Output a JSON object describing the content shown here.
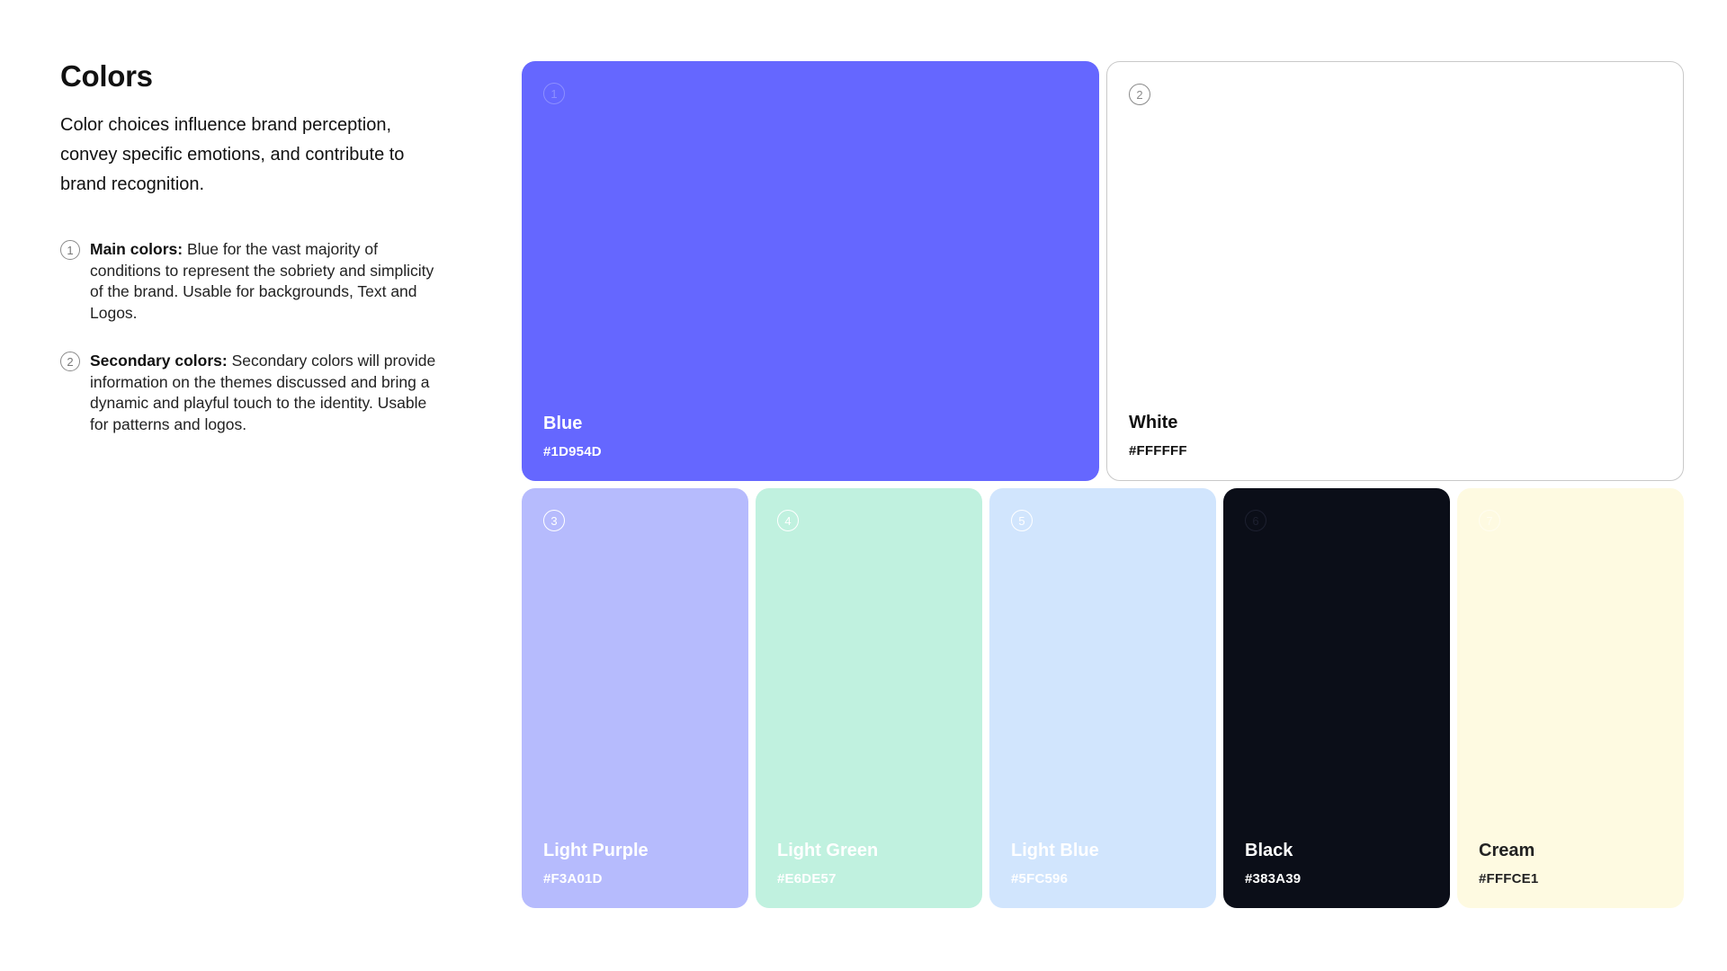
{
  "heading": {
    "title": "Colors",
    "intro": "Color choices influence brand perception, convey specific emotions, and contribute to brand recognition."
  },
  "notes": [
    {
      "number": "1",
      "label": "Main colors:",
      "text": "Blue for the vast majority of conditions to represent the sobriety and simplicity of the brand. Usable for backgrounds, Text and Logos."
    },
    {
      "number": "2",
      "label": "Secondary colors:",
      "text": "Secondary colors will provide information on the themes discussed and bring a dynamic and playful touch to the identity. Usable for patterns and logos."
    }
  ],
  "swatches": [
    {
      "number": "1",
      "name": "Blue",
      "hex": "#1D954D",
      "fill": "#6567ff",
      "text_color": "#ffffff",
      "number_color": "#8d8fff"
    },
    {
      "number": "2",
      "name": "White",
      "hex": "#FFFFFF",
      "fill": "#ffffff",
      "text_color": "#111111",
      "number_color": "#8a8a8a",
      "border": "#c9c9c9"
    },
    {
      "number": "3",
      "name": "Light Purple",
      "hex": "#F3A01D",
      "fill": "#b6bbfd",
      "text_color": "#ffffff",
      "number_color": "#ffffff"
    },
    {
      "number": "4",
      "name": "Light Green",
      "hex": "#E6DE57",
      "fill": "#c0f1df",
      "text_color": "#ffffff",
      "number_color": "#ffffff"
    },
    {
      "number": "5",
      "name": "Light Blue",
      "hex": "#5FC596",
      "fill": "#d1e5fd",
      "text_color": "#ffffff",
      "number_color": "#ffffff"
    },
    {
      "number": "6",
      "name": "Black",
      "hex": "#383A39",
      "fill": "#0b0e18",
      "text_color": "#ffffff",
      "number_color": "#1d2030"
    },
    {
      "number": "7",
      "name": "Cream",
      "hex": "#FFFCE1",
      "fill": "#fefae1",
      "text_color": "#222222",
      "number_color": "#fffdf0"
    }
  ]
}
